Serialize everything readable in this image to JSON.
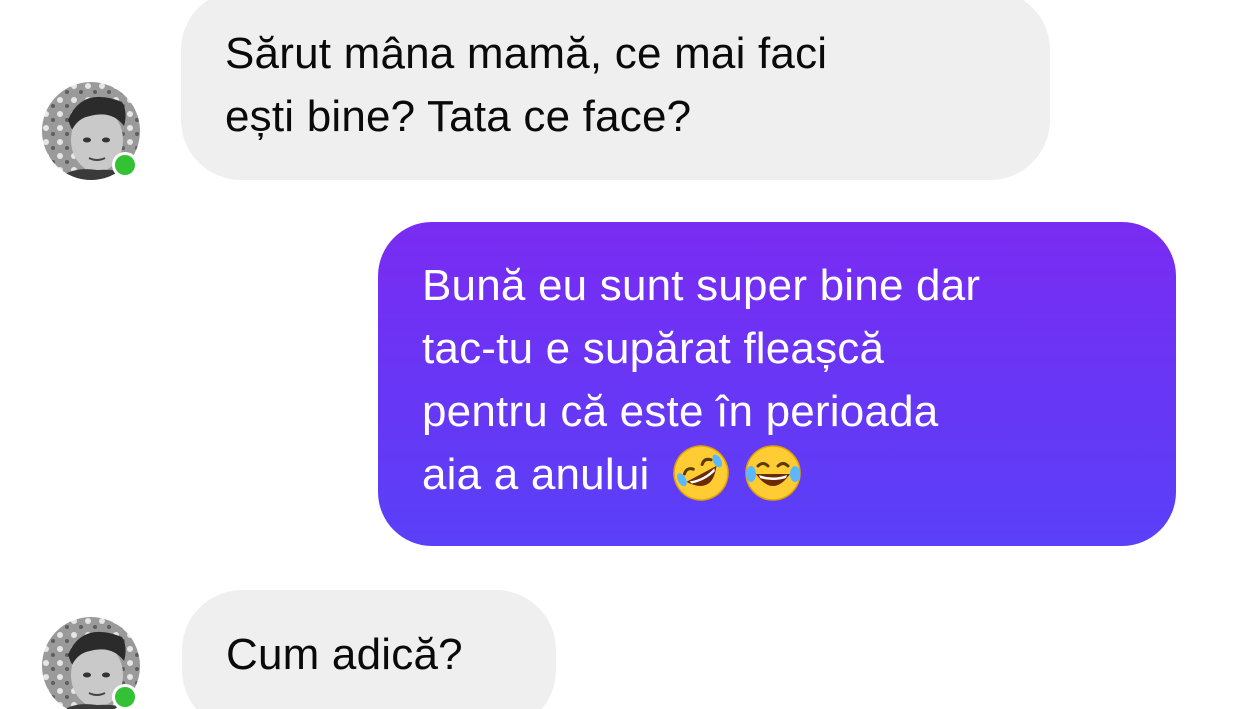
{
  "conversation": {
    "messages": [
      {
        "direction": "incoming",
        "lines": [
          "Sărut mâna mamă, ce mai faci",
          "ești bine? Tata ce face?"
        ]
      },
      {
        "direction": "outgoing",
        "lines": [
          "Bună eu sunt super bine dar",
          "tac-tu e supărat fleașcă",
          "pentru că este în perioada",
          "aia a anului"
        ],
        "emojis": [
          "rolling-on-floor-laughing-emoji",
          "tears-of-joy-emoji"
        ]
      },
      {
        "direction": "incoming",
        "lines": [
          "Cum adică?"
        ]
      }
    ]
  },
  "contact": {
    "avatar_icon": "contact-avatar",
    "status": "online",
    "status_color": "#34c235"
  },
  "colors": {
    "incoming_bubble": "#efefef",
    "outgoing_bubble_top": "#7a2bf2",
    "outgoing_bubble_bottom": "#5a40f8",
    "outgoing_text": "#ffffff",
    "incoming_text": "#0a0a0a"
  }
}
